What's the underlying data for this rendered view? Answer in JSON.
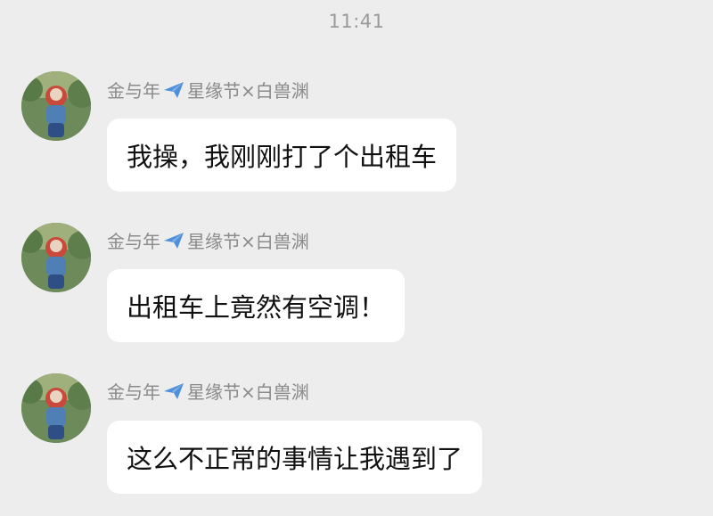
{
  "status": {
    "time": "11:41"
  },
  "messages": [
    {
      "sender_prefix": "金与年",
      "sender_icon": "airplane-icon",
      "sender_suffix": "星缘节×白兽渊",
      "text": "我操，我刚刚打了个出租车"
    },
    {
      "sender_prefix": "金与年",
      "sender_icon": "airplane-icon",
      "sender_suffix": "星缘节×白兽渊",
      "text": "出租车上竟然有空调！"
    },
    {
      "sender_prefix": "金与年",
      "sender_icon": "airplane-icon",
      "sender_suffix": "星缘节×白兽渊",
      "text": "这么不正常的事情让我遇到了"
    }
  ],
  "colors": {
    "background": "#ededed",
    "bubble": "#ffffff",
    "sender_text": "#8a8a8a",
    "timestamp_text": "#9a9a9a",
    "plane_icon": "#4f8fd9"
  }
}
